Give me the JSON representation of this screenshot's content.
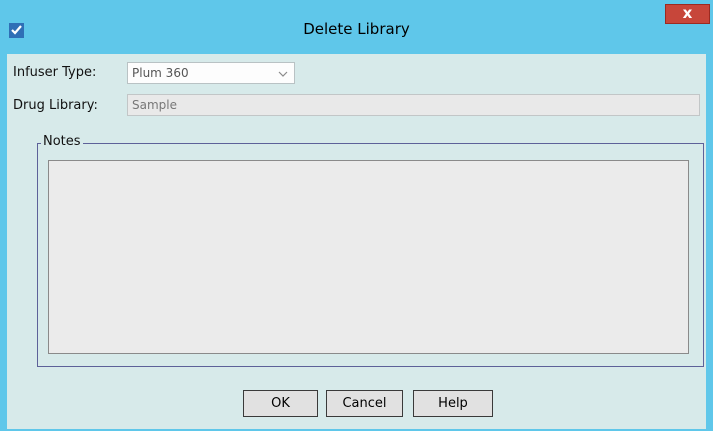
{
  "window": {
    "title": "Delete Library",
    "close_label": "x",
    "app_icon": "checkmark-doc-icon"
  },
  "form": {
    "infuser_type_label": "Infuser Type:",
    "infuser_type_value": "Plum 360",
    "drug_library_label": "Drug Library:",
    "drug_library_value": "Sample",
    "notes_label": "Notes",
    "notes_value": ""
  },
  "buttons": {
    "ok": "OK",
    "cancel": "Cancel",
    "help": "Help"
  },
  "colors": {
    "titlebar": "#5fc7ea",
    "client_bg": "#d7eaea",
    "close_button": "#c7463a",
    "group_border": "#5d6199"
  }
}
